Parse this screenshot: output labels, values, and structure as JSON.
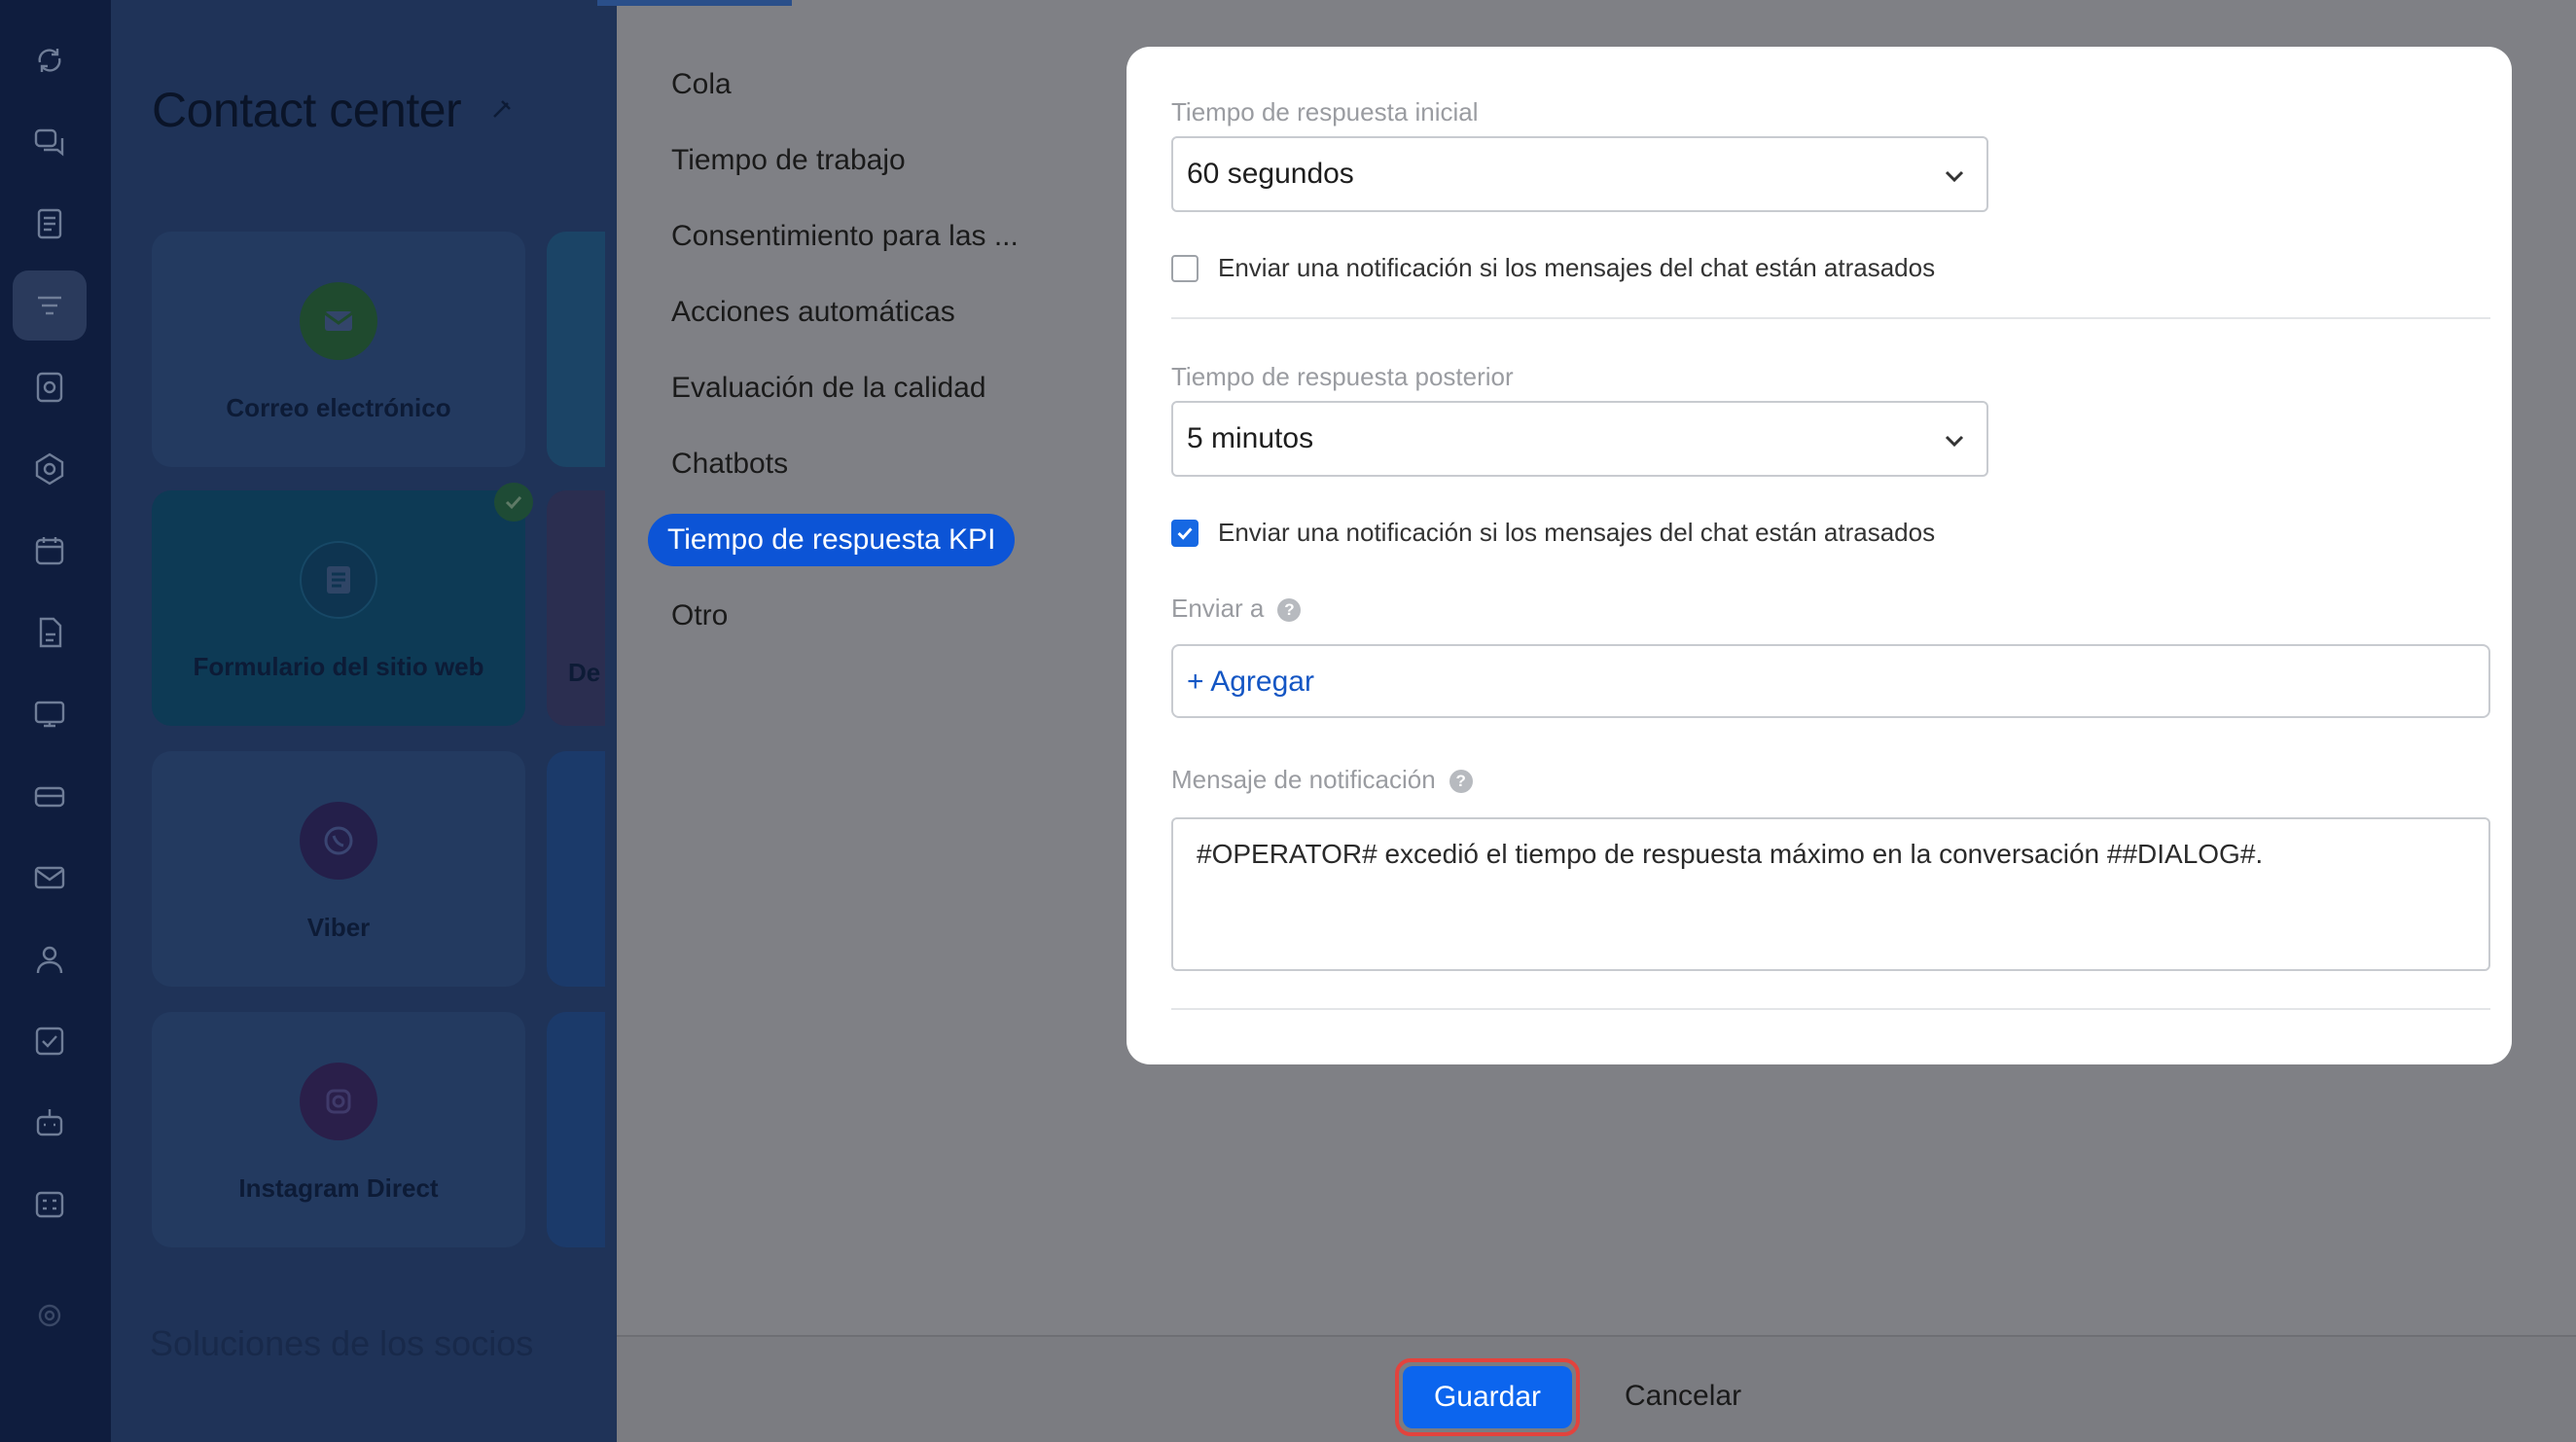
{
  "background": {
    "page_title": "Contact center",
    "tiles": [
      {
        "label": "Correo electrónico"
      },
      {
        "label": "Formulario del sitio web"
      },
      {
        "label": "Viber"
      },
      {
        "label": "Instagram Direct"
      }
    ],
    "partial_label": "De",
    "footer_text": "Soluciones de los socios"
  },
  "nav": {
    "items": [
      {
        "label": "Cola"
      },
      {
        "label": "Tiempo de trabajo"
      },
      {
        "label": "Consentimiento para las ..."
      },
      {
        "label": "Acciones automáticas"
      },
      {
        "label": "Evaluación de la calidad"
      },
      {
        "label": "Chatbots"
      },
      {
        "label": "Tiempo de respuesta KPI"
      },
      {
        "label": "Otro"
      }
    ],
    "active_index": 6
  },
  "form": {
    "initial": {
      "label": "Tiempo de respuesta inicial",
      "value": "60 segundos",
      "notify_label": "Enviar una notificación si los mensajes del chat están atrasados",
      "notify_checked": false
    },
    "subsequent": {
      "label": "Tiempo de respuesta posterior",
      "value": "5 minutos",
      "notify_label": "Enviar una notificación si los mensajes del chat están atrasados",
      "notify_checked": true
    },
    "send_to": {
      "label": "Enviar a",
      "add_label": "+ Agregar"
    },
    "message": {
      "label": "Mensaje de notificación",
      "value": "#OPERATOR# excedió el tiempo de respuesta máximo en la conversación ##DIALOG#."
    },
    "help_glyph": "?"
  },
  "footer": {
    "save_label": "Guardar",
    "cancel_label": "Cancelar"
  },
  "colors": {
    "accent": "#0c65ee",
    "nav_active": "#0c54d6",
    "highlight_ring": "#e2433d",
    "link": "#1456c4"
  }
}
